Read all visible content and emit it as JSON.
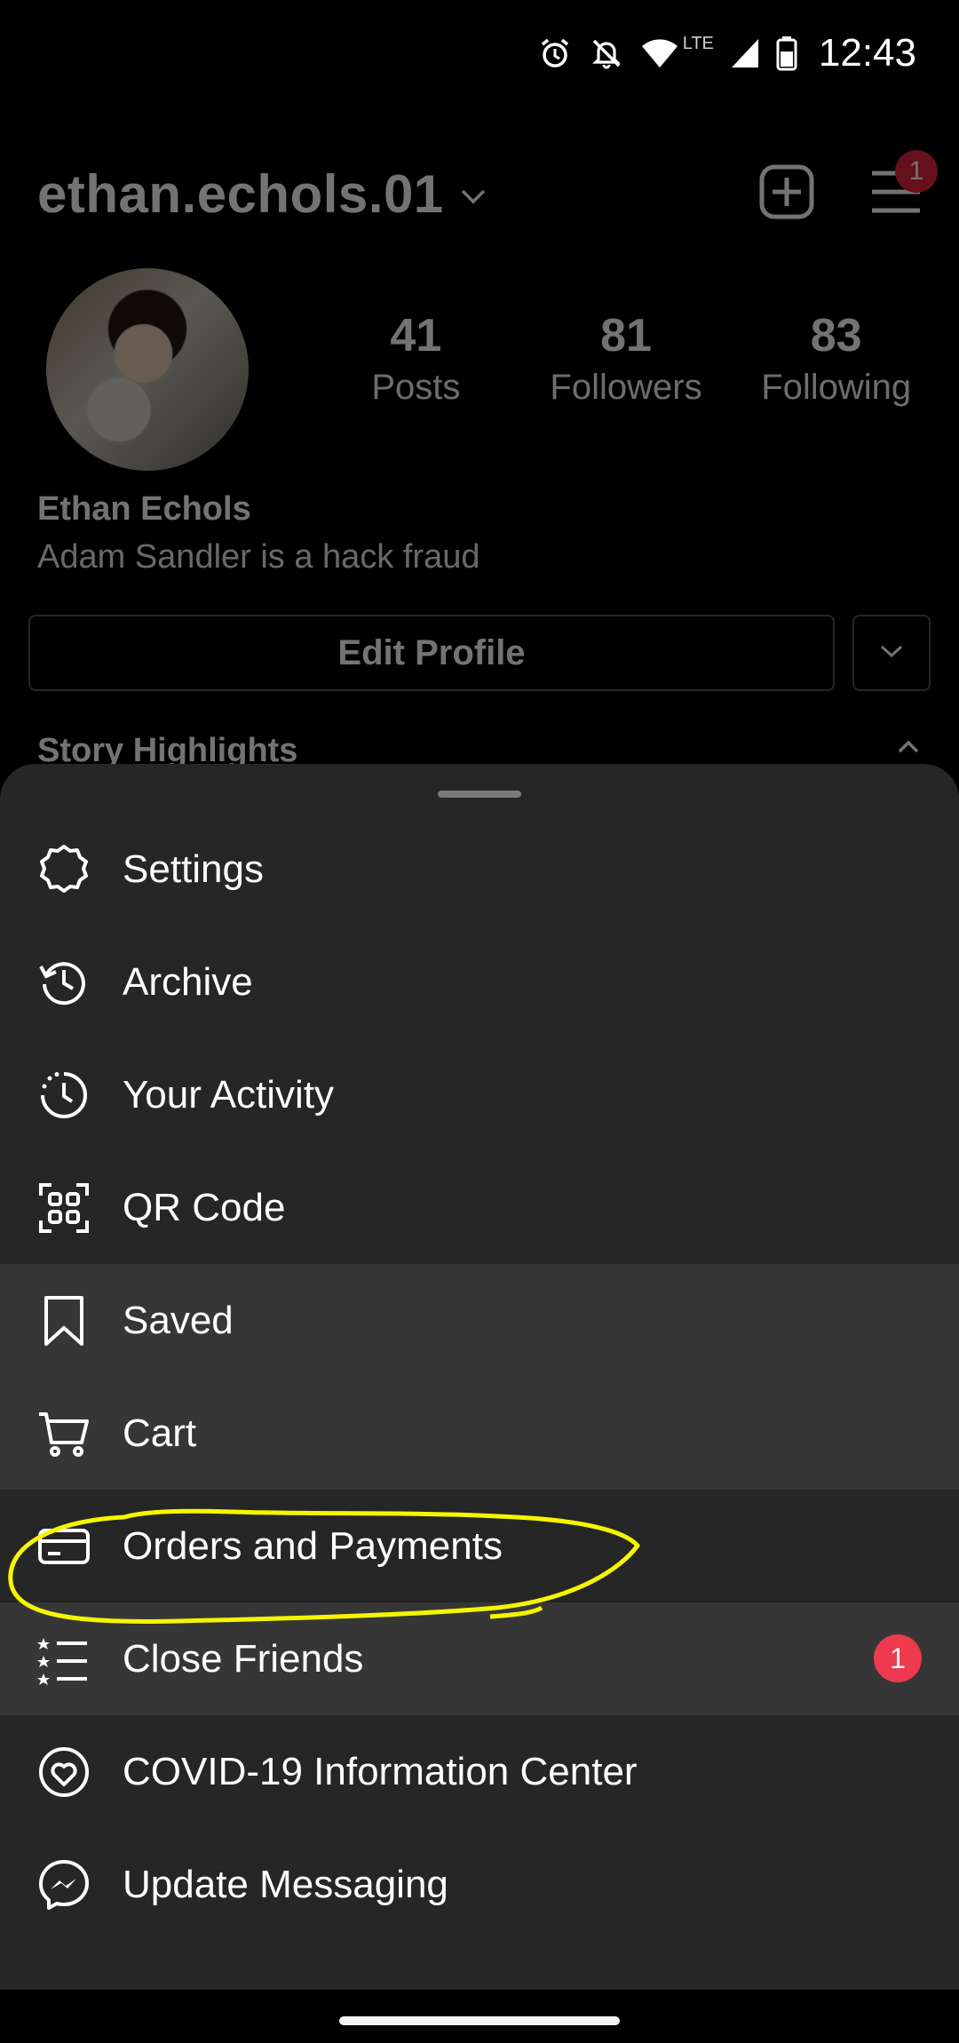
{
  "status_bar": {
    "time": "12:43",
    "network": "LTE",
    "icons": [
      "alarm-icon",
      "bell-off-icon",
      "wifi-icon",
      "signal-icon",
      "battery-icon"
    ]
  },
  "profile": {
    "username": "ethan.echols.01",
    "menu_badge": "1",
    "stats": [
      {
        "value": "41",
        "label": "Posts"
      },
      {
        "value": "81",
        "label": "Followers"
      },
      {
        "value": "83",
        "label": "Following"
      }
    ],
    "full_name": "Ethan Echols",
    "bio": "Adam Sandler is a hack fraud",
    "edit_profile_label": "Edit Profile",
    "story_highlights_label": "Story Highlights"
  },
  "sheet": {
    "items": [
      {
        "label": "Settings",
        "icon": "settings-icon"
      },
      {
        "label": "Archive",
        "icon": "archive-icon"
      },
      {
        "label": "Your Activity",
        "icon": "activity-icon"
      },
      {
        "label": "QR Code",
        "icon": "qr-code-icon"
      },
      {
        "label": "Saved",
        "icon": "bookmark-icon"
      },
      {
        "label": "Cart",
        "icon": "cart-icon"
      },
      {
        "label": "Orders and Payments",
        "icon": "card-icon"
      },
      {
        "label": "Close Friends",
        "icon": "close-friends-icon",
        "badge": "1"
      },
      {
        "label": "COVID-19 Information Center",
        "icon": "covid-info-icon"
      },
      {
        "label": "Update Messaging",
        "icon": "messenger-icon"
      }
    ]
  },
  "colors": {
    "sheet_background": "#262626",
    "highlight_row": "#363636",
    "badge_red": "#ed3a4f",
    "annotation_yellow": "#f5f500"
  }
}
